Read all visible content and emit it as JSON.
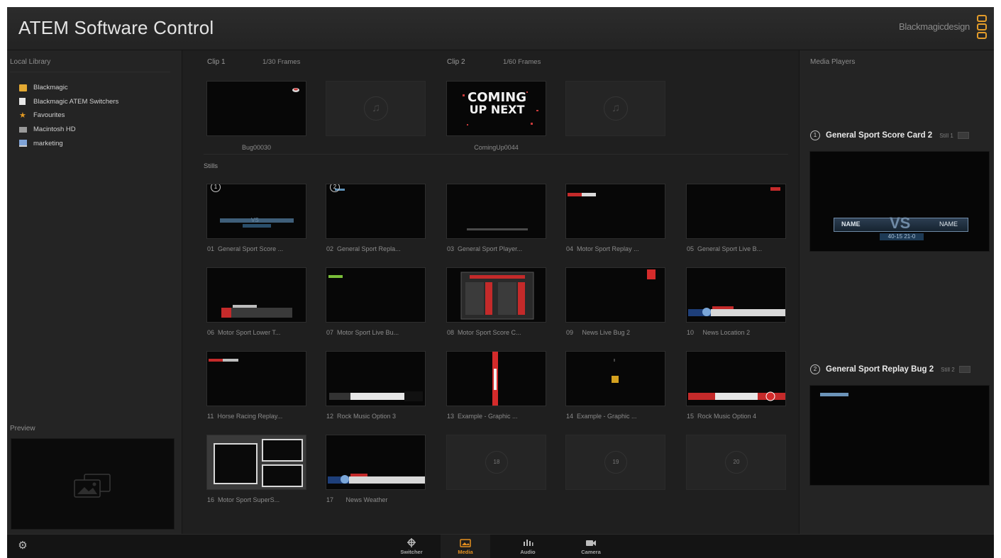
{
  "app": {
    "title": "ATEM Software Control",
    "brand": "Blackmagicdesign"
  },
  "library": {
    "heading": "Local Library",
    "items": [
      {
        "label": "Blackmagic",
        "icon": "folder-icon"
      },
      {
        "label": "Blackmagic ATEM Switchers",
        "icon": "document-icon"
      },
      {
        "label": "Favourites",
        "icon": "star-icon"
      },
      {
        "label": "Macintosh HD",
        "icon": "drive-icon"
      },
      {
        "label": "marketing",
        "icon": "computer-icon"
      }
    ]
  },
  "preview": {
    "heading": "Preview"
  },
  "clips": [
    {
      "heading": "Clip 1",
      "frames": "1/30 Frames",
      "name": "Bug00030"
    },
    {
      "heading": "Clip 2",
      "frames": "1/60 Frames",
      "name": "ComingUp0044",
      "graphic_text_1": "COMING",
      "graphic_text_2": "UP NEXT"
    }
  ],
  "stills": {
    "heading": "Stills",
    "items": [
      {
        "number": "01",
        "label": "General Sport Score ...",
        "badge": "1"
      },
      {
        "number": "02",
        "label": "General Sport Repla...",
        "badge": "2"
      },
      {
        "number": "03",
        "label": "General Sport Player..."
      },
      {
        "number": "04",
        "label": "Motor Sport Replay ..."
      },
      {
        "number": "05",
        "label": "General Sport Live B..."
      },
      {
        "number": "06",
        "label": "Motor Sport Lower T..."
      },
      {
        "number": "07",
        "label": "Motor Sport Live Bu..."
      },
      {
        "number": "08",
        "label": "Motor Sport Score C..."
      },
      {
        "number": "09",
        "label": "News Live Bug 2"
      },
      {
        "number": "10",
        "label": "News Location 2"
      },
      {
        "number": "11",
        "label": "Horse Racing Replay..."
      },
      {
        "number": "12",
        "label": "Rock Music Option 3"
      },
      {
        "number": "13",
        "label": "Example - Graphic ..."
      },
      {
        "number": "14",
        "label": "Example - Graphic ..."
      },
      {
        "number": "15",
        "label": "Rock Music Option 4"
      },
      {
        "number": "16",
        "label": "Motor Sport SuperS..."
      },
      {
        "number": "17",
        "label": "News Weather"
      }
    ],
    "empty_slots": [
      "18",
      "19",
      "20"
    ]
  },
  "media_players": {
    "heading": "Media Players",
    "players": [
      {
        "number": "1",
        "name": "General Sport Score Card 2",
        "still": "Still 1",
        "graphic_left": "NAME",
        "graphic_mid": "VS",
        "graphic_right": "NAME",
        "graphic_score": "40-15  21-0"
      },
      {
        "number": "2",
        "name": "General Sport Replay Bug 2",
        "still": "Still 2"
      }
    ]
  },
  "nav": {
    "tabs": [
      {
        "label": "Switcher",
        "icon": "switcher-icon"
      },
      {
        "label": "Media",
        "icon": "media-icon",
        "active": true
      },
      {
        "label": "Audio",
        "icon": "audio-icon"
      },
      {
        "label": "Camera",
        "icon": "camera-icon"
      }
    ]
  },
  "colors": {
    "accent": "#e6901e",
    "background": "#1f1f1f",
    "panel": "#242424",
    "brand_logo": "#e39c2a"
  }
}
